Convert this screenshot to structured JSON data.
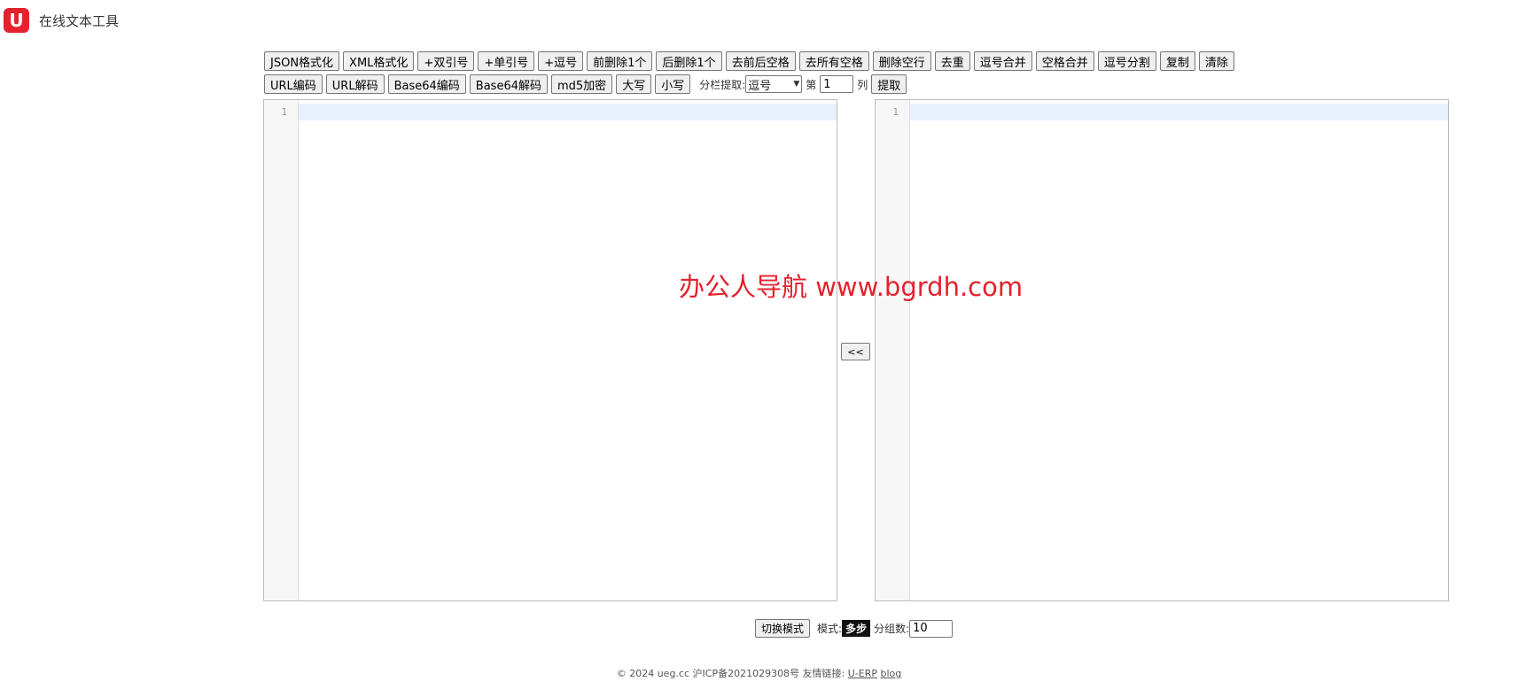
{
  "header": {
    "logo_letter": "U",
    "title": "在线文本工具",
    "brand_color": "#e4212d"
  },
  "toolbar_row1": [
    {
      "name": "json-format-button",
      "label": "JSON格式化"
    },
    {
      "name": "xml-format-button",
      "label": "XML格式化"
    },
    {
      "name": "add-double-quote-button",
      "label": "+双引号"
    },
    {
      "name": "add-single-quote-button",
      "label": "+单引号"
    },
    {
      "name": "add-comma-button",
      "label": "+逗号"
    },
    {
      "name": "delete-first-char-button",
      "label": "前删除1个"
    },
    {
      "name": "delete-last-char-button",
      "label": "后删除1个"
    },
    {
      "name": "trim-spaces-button",
      "label": "去前后空格"
    },
    {
      "name": "remove-all-spaces-button",
      "label": "去所有空格"
    },
    {
      "name": "delete-empty-lines-button",
      "label": "删除空行"
    },
    {
      "name": "dedupe-button",
      "label": "去重"
    },
    {
      "name": "comma-merge-button",
      "label": "逗号合并"
    },
    {
      "name": "space-merge-button",
      "label": "空格合并"
    },
    {
      "name": "comma-split-button",
      "label": "逗号分割"
    },
    {
      "name": "copy-button",
      "label": "复制"
    },
    {
      "name": "clear-button",
      "label": "清除"
    }
  ],
  "toolbar_row2": {
    "buttons": [
      {
        "name": "url-encode-button",
        "label": "URL编码"
      },
      {
        "name": "url-decode-button",
        "label": "URL解码"
      },
      {
        "name": "base64-encode-button",
        "label": "Base64编码"
      },
      {
        "name": "base64-decode-button",
        "label": "Base64解码"
      },
      {
        "name": "md5-encrypt-button",
        "label": "md5加密"
      },
      {
        "name": "uppercase-button",
        "label": "大写"
      },
      {
        "name": "lowercase-button",
        "label": "小写"
      }
    ],
    "extract_label": "分栏提取:",
    "delimiter_value": "逗号",
    "column_prefix": "第",
    "column_value": "1",
    "column_suffix": "列",
    "extract_button": "提取"
  },
  "editors": {
    "left_line_number": "1",
    "right_line_number": "1",
    "swap_label": "<<"
  },
  "watermark": "办公人导航 www.bgrdh.com",
  "bottom": {
    "toggle_mode_label": "切换模式",
    "mode_label": "模式:",
    "mode_value": "多步",
    "group_count_label": "分组数:",
    "group_count_value": "10"
  },
  "footer": {
    "copyright": "© 2024 ueg.cc 沪ICP备2021029308号 友情链接:",
    "link1": "U-ERP",
    "link2": "blog"
  }
}
